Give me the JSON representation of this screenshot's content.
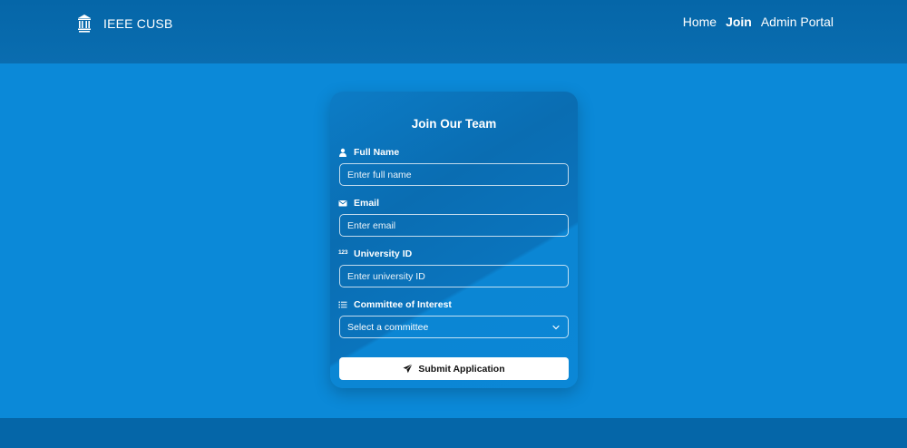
{
  "navbar": {
    "brand_name": "IEEE CUSB",
    "brand_icon": "institution-building-icon",
    "links": [
      {
        "label": "Home"
      },
      {
        "label": "Join"
      },
      {
        "label": "Admin Portal"
      }
    ],
    "active_link": "Join"
  },
  "form": {
    "title": "Join Our Team",
    "full_name": {
      "label": "Full Name",
      "icon": "person-icon",
      "placeholder": "Enter full name",
      "value": ""
    },
    "email": {
      "label": "Email",
      "icon": "envelope-icon",
      "placeholder": "Enter email",
      "value": ""
    },
    "university_id": {
      "label": "University ID",
      "icon": "numeric-123-icon",
      "icon_text": "123",
      "placeholder": "Enter university ID",
      "value": ""
    },
    "committee": {
      "label": "Committee of Interest",
      "icon": "list-icon",
      "selected": "Select a committee"
    },
    "submit_label": "Submit Application",
    "submit_icon": "send-arrow-icon"
  },
  "colors": {
    "page_background": "#0b89d8",
    "navbar_background": "#0566a8",
    "footer_background": "#0566a8",
    "button_background": "#ffffff"
  }
}
